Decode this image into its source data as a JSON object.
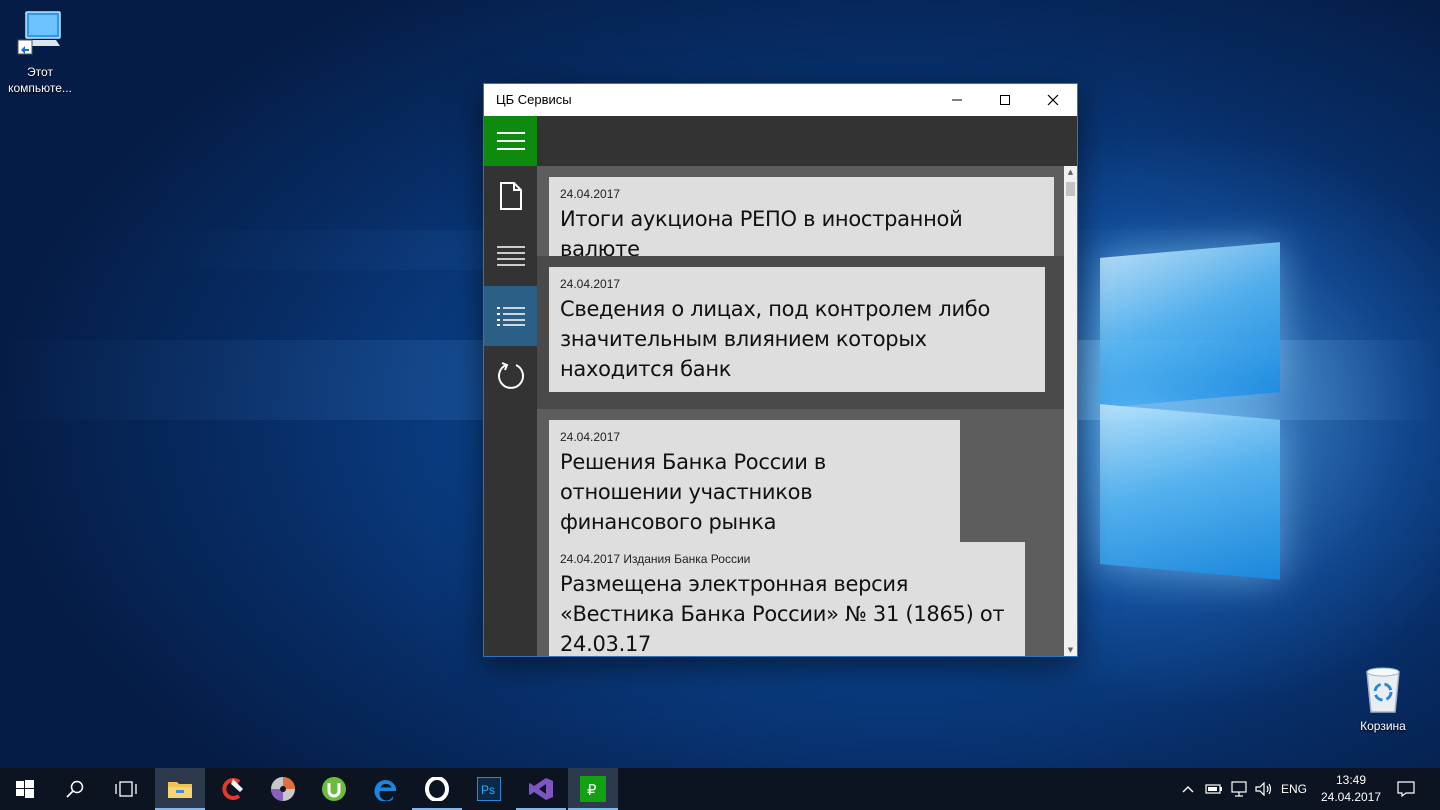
{
  "desktop": {
    "icons": [
      {
        "label": "Этот компьюте...",
        "icon": "this-pc-icon"
      },
      {
        "label": "Корзина",
        "icon": "recycle-bin-icon"
      }
    ]
  },
  "window": {
    "title": "ЦБ Сервисы",
    "controls": {
      "minimize": "minimize-icon",
      "maximize": "maximize-icon",
      "close": "close-icon"
    },
    "accent_color": "#0e8a0e",
    "active_nav_color": "#2c5f86"
  },
  "sidebar": {
    "items": [
      {
        "icon": "document-icon",
        "active": false
      },
      {
        "icon": "list-icon",
        "active": false
      },
      {
        "icon": "bulleted-list-icon",
        "active": true
      },
      {
        "icon": "refresh-icon",
        "active": false
      }
    ]
  },
  "news": [
    {
      "meta": "24.04.2017",
      "headline": "Итоги аукциона РЕПО в иностранной валюте",
      "selected": false
    },
    {
      "meta": "24.04.2017",
      "headline": "Сведения о лицах, под контролем либо значительным влиянием которых находится банк",
      "selected": true
    },
    {
      "meta": "24.04.2017",
      "headline": "Решения Банка России в отношении участников финансового рынка",
      "selected": false
    },
    {
      "meta": "24.04.2017 Издания Банка России",
      "headline": "Размещена электронная версия «Вестника Банка России» № 31 (1865) от 24.03.17",
      "selected": false
    }
  ],
  "taskbar": {
    "apps": [
      "start-icon",
      "search-icon",
      "task-view-icon",
      "file-explorer-icon",
      "ccleaner-icon",
      "dvd-icon",
      "utorrent-icon",
      "edge-icon",
      "opera-icon",
      "photoshop-icon",
      "visual-studio-icon",
      "cb-services-icon"
    ],
    "photoshop_label": "Ps",
    "cb_label": "₽",
    "tray": {
      "language": "ENG",
      "time": "13:49",
      "date": "24.04.2017"
    }
  }
}
